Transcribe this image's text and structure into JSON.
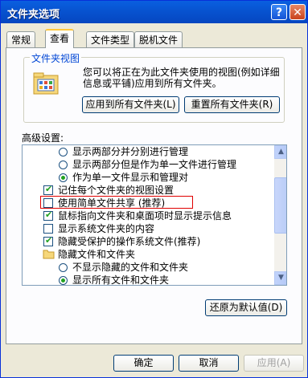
{
  "window": {
    "title": "文件夹选项"
  },
  "tabs": [
    {
      "label": "常规"
    },
    {
      "label": "查看"
    },
    {
      "label": "文件类型"
    },
    {
      "label": "脱机文件"
    }
  ],
  "folder_view": {
    "legend": "文件夹视图",
    "description": "您可以将正在为此文件夹使用的视图(例如详细信息或平铺)应用到所有文件夹。",
    "apply_all_label": "应用到所有文件夹(L)",
    "reset_all_label": "重置所有文件夹(R)"
  },
  "advanced": {
    "label": "高级设置:",
    "items": [
      {
        "type": "radio",
        "checked": false,
        "text": "显示两部分并分别进行管理"
      },
      {
        "type": "radio",
        "checked": false,
        "text": "显示两部分但是作为单一文件进行管理"
      },
      {
        "type": "radio",
        "checked": true,
        "text": "作为单一文件显示和管理对"
      },
      {
        "type": "checkbox",
        "checked": true,
        "text": "记住每个文件夹的视图设置"
      },
      {
        "type": "checkbox",
        "checked": false,
        "text": "使用简单文件共享 (推荐)"
      },
      {
        "type": "checkbox",
        "checked": true,
        "text": "鼠标指向文件夹和桌面项时显示提示信息"
      },
      {
        "type": "checkbox",
        "checked": false,
        "text": "显示系统文件夹的内容"
      },
      {
        "type": "checkbox",
        "checked": true,
        "text": "隐藏受保护的操作系统文件(推荐)"
      },
      {
        "type": "folder",
        "text": "隐藏文件和文件夹"
      },
      {
        "type": "radio",
        "checked": false,
        "text": "不显示隐藏的文件和文件夹"
      },
      {
        "type": "radio",
        "checked": true,
        "text": "显示所有文件和文件夹"
      }
    ],
    "restore_defaults_label": "还原为默认值(D)"
  },
  "footer": {
    "ok_label": "确定",
    "cancel_label": "取消",
    "apply_label": "应用(A)"
  }
}
